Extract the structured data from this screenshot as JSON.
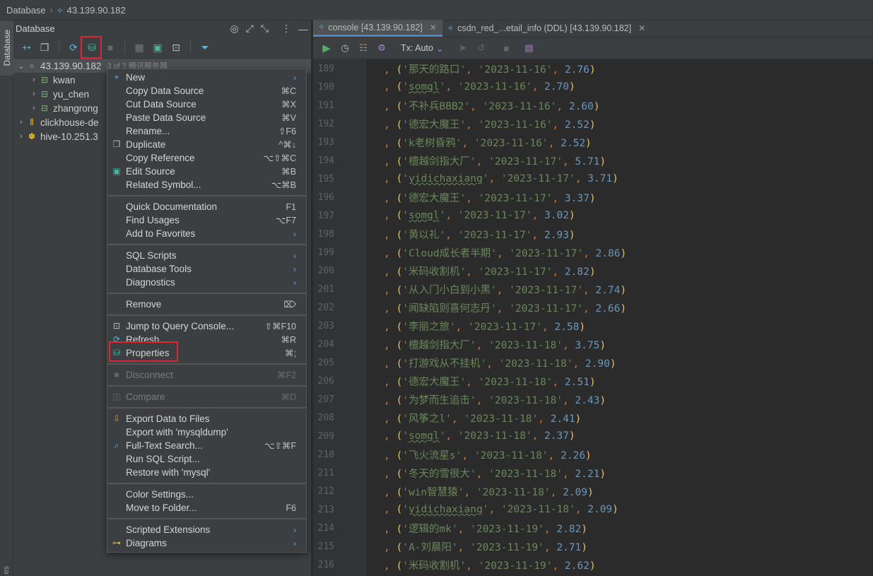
{
  "breadcrumb": {
    "root": "Database",
    "host": "43.139.90.182"
  },
  "left_strip": {
    "tab_label": "Database",
    "bottom_label": "es"
  },
  "db_panel": {
    "title": "Database",
    "tree": [
      {
        "label": "43.139.90.182",
        "sub": "3 of 7   腾讯服务器",
        "icon": "mysql-icon",
        "expanded": true,
        "level": 0
      },
      {
        "label": "kwan",
        "icon": "schema-icon",
        "level": 1
      },
      {
        "label": "yu_chen",
        "icon": "schema-icon",
        "level": 1
      },
      {
        "label": "zhangrong",
        "icon": "schema-icon",
        "level": 1
      },
      {
        "label": "clickhouse-de",
        "icon": "clickhouse-icon",
        "level": 0
      },
      {
        "label": "hive-10.251.3",
        "icon": "hive-icon",
        "level": 0
      }
    ]
  },
  "context_menu": {
    "groups": [
      [
        {
          "label": "New",
          "submenu": true,
          "icon": "plus-icon"
        },
        {
          "label": "Copy Data Source",
          "shortcut": "⌘C"
        },
        {
          "label": "Cut Data Source",
          "shortcut": "⌘X"
        },
        {
          "label": "Paste Data Source",
          "shortcut": "⌘V"
        },
        {
          "label": "Rename...",
          "shortcut": "⇧F6"
        },
        {
          "label": "Duplicate",
          "shortcut": "^⌘↓",
          "icon": "duplicate-icon"
        },
        {
          "label": "Copy Reference",
          "shortcut": "⌥⇧⌘C"
        },
        {
          "label": "Edit Source",
          "shortcut": "⌘B",
          "icon": "edit-source-icon"
        },
        {
          "label": "Related Symbol...",
          "shortcut": "⌥⌘B"
        }
      ],
      [
        {
          "label": "Quick Documentation",
          "shortcut": "F1"
        },
        {
          "label": "Find Usages",
          "shortcut": "⌥F7"
        },
        {
          "label": "Add to Favorites",
          "submenu": true
        }
      ],
      [
        {
          "label": "SQL Scripts",
          "submenu": true
        },
        {
          "label": "Database Tools",
          "submenu": true
        },
        {
          "label": "Diagnostics",
          "submenu": true
        }
      ],
      [
        {
          "label": "Remove",
          "shortcut": "⌦"
        }
      ],
      [
        {
          "label": "Jump to Query Console...",
          "shortcut": "⇧⌘F10",
          "icon": "console-icon"
        },
        {
          "label": "Refresh",
          "shortcut": "⌘R",
          "icon": "refresh-icon"
        },
        {
          "label": "Properties",
          "shortcut": "⌘;",
          "icon": "properties-icon",
          "highlighted": true
        }
      ],
      [
        {
          "label": "Disconnect",
          "shortcut": "⌘F2",
          "icon": "stop-icon",
          "disabled": true
        }
      ],
      [
        {
          "label": "Compare",
          "shortcut": "⌘D",
          "icon": "compare-icon",
          "disabled": true
        }
      ],
      [
        {
          "label": "Export Data to Files",
          "icon": "export-icon"
        },
        {
          "label": "Export with 'mysqldump'"
        },
        {
          "label": "Full-Text Search...",
          "shortcut": "⌥⇧⌘F",
          "icon": "search-icon"
        },
        {
          "label": "Run SQL Script..."
        },
        {
          "label": "Restore with 'mysql'"
        }
      ],
      [
        {
          "label": "Color Settings..."
        },
        {
          "label": "Move to Folder...",
          "shortcut": "F6"
        }
      ],
      [
        {
          "label": "Scripted Extensions",
          "submenu": true
        },
        {
          "label": "Diagrams",
          "submenu": true,
          "icon": "diagram-icon"
        }
      ]
    ]
  },
  "editor": {
    "tabs": [
      {
        "label": "console [43.139.90.182]",
        "active": true
      },
      {
        "label": "csdn_red_...etail_info (DDL) [43.139.90.182]",
        "active": false
      }
    ],
    "tx_mode": "Tx: Auto",
    "lines": [
      {
        "n": "189",
        "name": "那天的路口",
        "date": "2023-11-16",
        "val": "2.76"
      },
      {
        "n": "190",
        "name": "somgl",
        "date": "2023-11-16",
        "val": "2.70",
        "wavy": true
      },
      {
        "n": "191",
        "name": "不补兵BBB2",
        "date": "2023-11-16",
        "val": "2.60"
      },
      {
        "n": "192",
        "name": "德宏大魔王",
        "date": "2023-11-16",
        "val": "2.52"
      },
      {
        "n": "193",
        "name": "k老树昏鸦",
        "date": "2023-11-16",
        "val": "2.52"
      },
      {
        "n": "194",
        "name": "檀越剑指大厂",
        "date": "2023-11-17",
        "val": "5.71"
      },
      {
        "n": "195",
        "name": "yidichaxiang",
        "date": "2023-11-17",
        "val": "3.71",
        "wavy": true
      },
      {
        "n": "196",
        "name": "德宏大魔王",
        "date": "2023-11-17",
        "val": "3.37"
      },
      {
        "n": "197",
        "name": "somgl",
        "date": "2023-11-17",
        "val": "3.02",
        "wavy": true
      },
      {
        "n": "198",
        "name": "黄以礼",
        "date": "2023-11-17",
        "val": "2.93"
      },
      {
        "n": "199",
        "name": "Cloud成长者半期",
        "date": "2023-11-17",
        "val": "2.86"
      },
      {
        "n": "200",
        "name": "米码收割机",
        "date": "2023-11-17",
        "val": "2.82"
      },
      {
        "n": "201",
        "name": "从入门小白到小黑",
        "date": "2023-11-17",
        "val": "2.74"
      },
      {
        "n": "202",
        "name": "闻缺陷则喜何志丹",
        "date": "2023-11-17",
        "val": "2.66"
      },
      {
        "n": "203",
        "name": "李丽之旅",
        "date": "2023-11-17",
        "val": "2.58"
      },
      {
        "n": "204",
        "name": "檀越剑指大厂",
        "date": "2023-11-18",
        "val": "3.75"
      },
      {
        "n": "205",
        "name": "打游戏从不挂机",
        "date": "2023-11-18",
        "val": "2.90"
      },
      {
        "n": "206",
        "name": "德宏大魔王",
        "date": "2023-11-18",
        "val": "2.51"
      },
      {
        "n": "207",
        "name": "为梦而生追击",
        "date": "2023-11-18",
        "val": "2.43"
      },
      {
        "n": "208",
        "name": "风筝之l",
        "date": "2023-11-18",
        "val": "2.41"
      },
      {
        "n": "209",
        "name": "somgl",
        "date": "2023-11-18",
        "val": "2.37",
        "wavy": true
      },
      {
        "n": "210",
        "name": "飞火流星s",
        "date": "2023-11-18",
        "val": "2.26"
      },
      {
        "n": "211",
        "name": "冬天的雪很大",
        "date": "2023-11-18",
        "val": "2.21"
      },
      {
        "n": "212",
        "name": "win智慧猿",
        "date": "2023-11-18",
        "val": "2.09"
      },
      {
        "n": "213",
        "name": "yidichaxiang",
        "date": "2023-11-18",
        "val": "2.09",
        "wavy": true
      },
      {
        "n": "214",
        "name": "逻辑的mk",
        "date": "2023-11-19",
        "val": "2.82"
      },
      {
        "n": "215",
        "name": "A-刘晨阳",
        "date": "2023-11-19",
        "val": "2.71"
      },
      {
        "n": "216",
        "name": "米码收割机",
        "date": "2023-11-19",
        "val": "2.62"
      }
    ]
  }
}
